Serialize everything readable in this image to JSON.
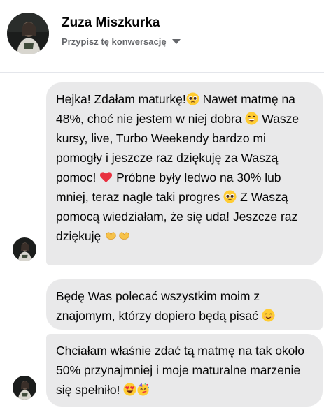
{
  "contact": {
    "name": "Zuza Miszkurka",
    "assign_label": "Przypisz tę konwersację"
  },
  "messages": [
    {
      "segments": {
        "s1": "Hejka! Zdałam maturkę!",
        "s2": " Nawet matmę na 48%, choć nie jestem w niej dobra ",
        "s3": " Wasze kursy, live, Turbo Weekendy bardzo mi pomogły i jeszcze raz dziękuję za Waszą pomoc! ",
        "s4": " Próbne były ledwo na 30% lub mniej, teraz nagle taki progres ",
        "s5": " Z Waszą pomocą wiedziałam, że się uda! Jeszcze raz dziękuję "
      }
    },
    {
      "segments": {
        "s1": "Będę Was polecać wszystkim moim z znajomym, którzy dopiero będą pisać "
      }
    },
    {
      "segments": {
        "s1": "Chciałam właśnie zdać tą matmę na tak około 50% przynajmniej i moje maturalne marzenie się spełniło! "
      }
    }
  ],
  "emojis": [
    "pleading-face-emoji",
    "grinning-face-emoji",
    "red-heart-emoji",
    "pleading-face-emoji",
    "heart-hands-emoji",
    "smiling-face-emoji",
    "heart-eyes-emoji",
    "partying-face-emoji"
  ],
  "colors": {
    "bubble": "#e9e9ea",
    "text": "#050505",
    "secondary_text": "#65676b"
  }
}
